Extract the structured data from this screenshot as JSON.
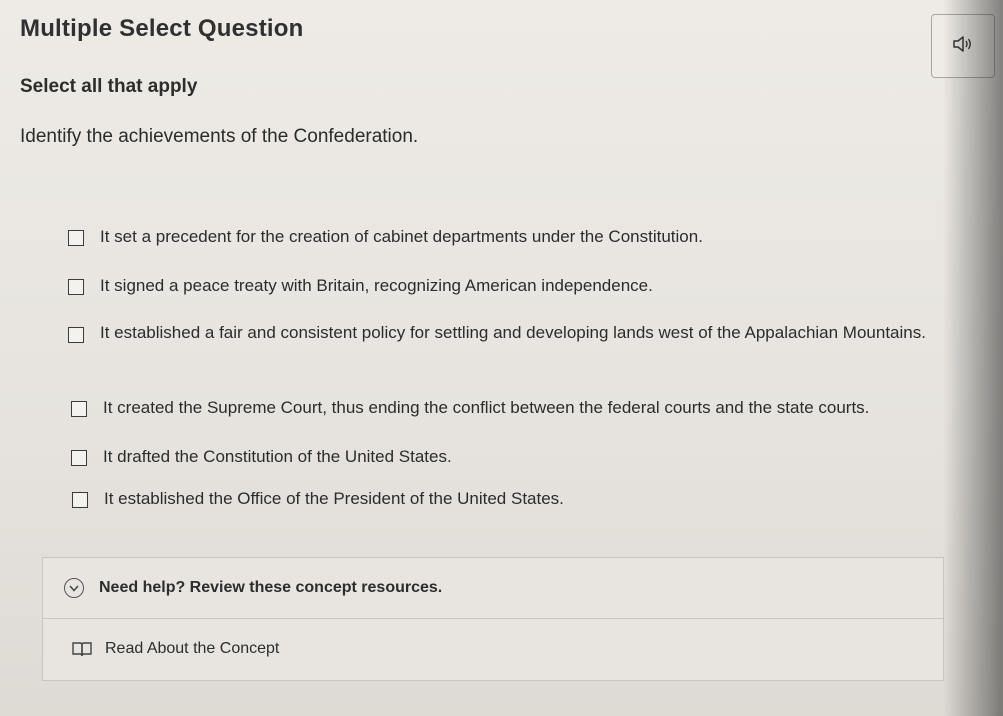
{
  "header": {
    "title": "Multiple Select Question"
  },
  "question": {
    "instruction": "Select all that apply",
    "prompt": "Identify the achievements of the Confederation."
  },
  "options": [
    {
      "text": "It set a precedent for the creation of cabinet departments under the Constitution.",
      "checked": false
    },
    {
      "text": "It signed a peace treaty with Britain, recognizing American independence.",
      "checked": false
    },
    {
      "text": "It established a fair and consistent policy for settling and developing lands west of the Appalachian Mountains.",
      "checked": false
    },
    {
      "text": "It created the Supreme Court, thus ending the conflict between the federal courts and the state courts.",
      "checked": false
    },
    {
      "text": "It drafted the Constitution of the United States.",
      "checked": false
    },
    {
      "text": "It established the Office of the President of the United States.",
      "checked": false
    }
  ],
  "help": {
    "toggle_label": "Need help? Review these concept resources.",
    "toggle_icon": "chevron-down-icon",
    "resource_label": "Read About the Concept",
    "resource_icon": "book-icon"
  },
  "controls": {
    "audio_icon": "speaker-icon"
  }
}
